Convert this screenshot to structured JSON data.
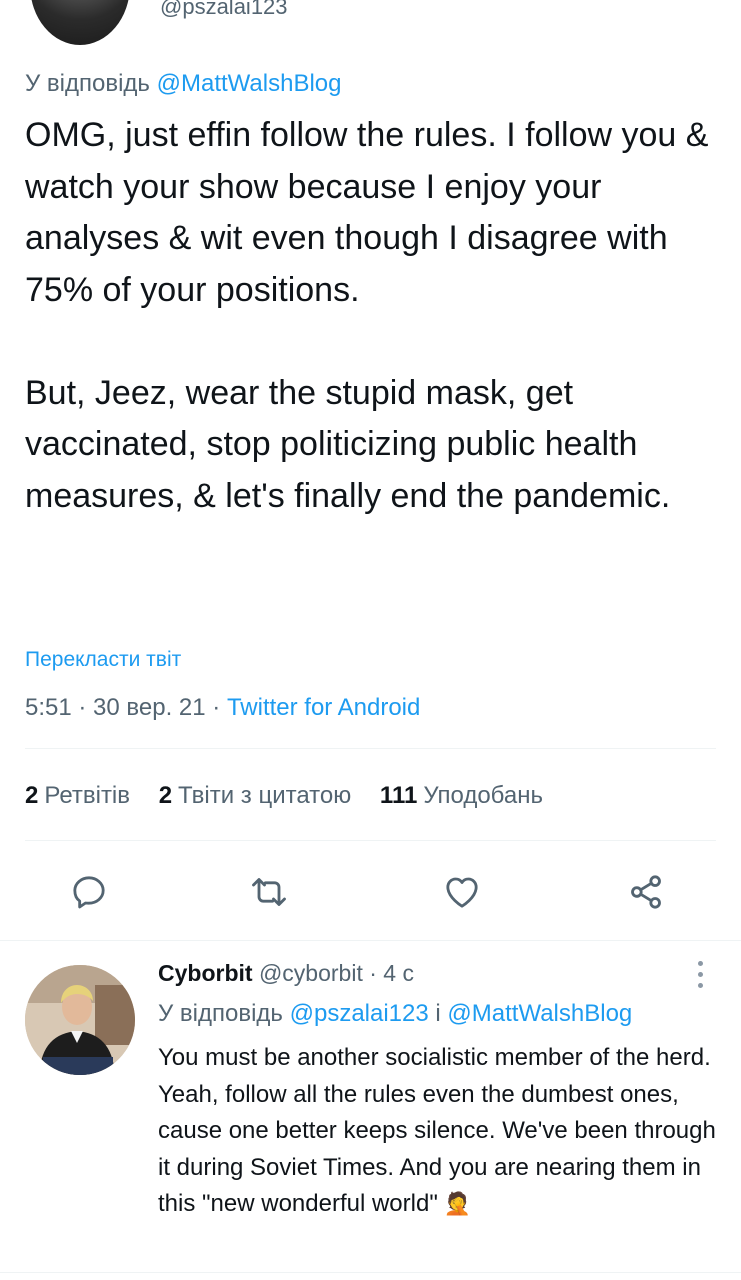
{
  "prev_tweet": {
    "handle": "@pszalai123"
  },
  "tweet": {
    "reply_prefix": "У відповідь ",
    "reply_mention": "@MattWalshBlog",
    "paragraph1": "OMG, just effin follow the rules. I follow you & watch your show because I enjoy your analyses & wit even though I disagree with 75% of your positions.",
    "paragraph2": "But, Jeez, wear the stupid mask, get vaccinated, stop politicizing public health measures, & let's finally end the pandemic.",
    "translate_label": "Перекласти твіт",
    "time": "5:51 · 30 вер. 21 · ",
    "source": "Twitter for Android",
    "stats": {
      "retweets_count": "2",
      "retweets_label": "Ретвітів",
      "quotes_count": "2",
      "quotes_label": "Твіти з цитатою",
      "likes_count": "111",
      "likes_label": "Уподобань"
    }
  },
  "reply": {
    "name": "Cyborbit",
    "handle_time": " @cyborbit · 4 с",
    "reply_prefix": "У відповідь ",
    "mention1": "@pszalai123",
    "conj": " і ",
    "mention2": "@MattWalshBlog",
    "text": "You must be another socialistic member of the herd. Yeah, follow all the rules even the dumbest ones, cause one better keeps silence. We've been through it during Soviet Times. And you are nearing them in this \"new wonderful world\"",
    "emoji": "🤦"
  },
  "icons": [
    "reply-icon",
    "retweet-icon",
    "like-icon",
    "share-icon",
    "more-icon"
  ],
  "colors": {
    "link": "#1d9bf0",
    "secondary": "#536471",
    "text": "#0f1419"
  }
}
